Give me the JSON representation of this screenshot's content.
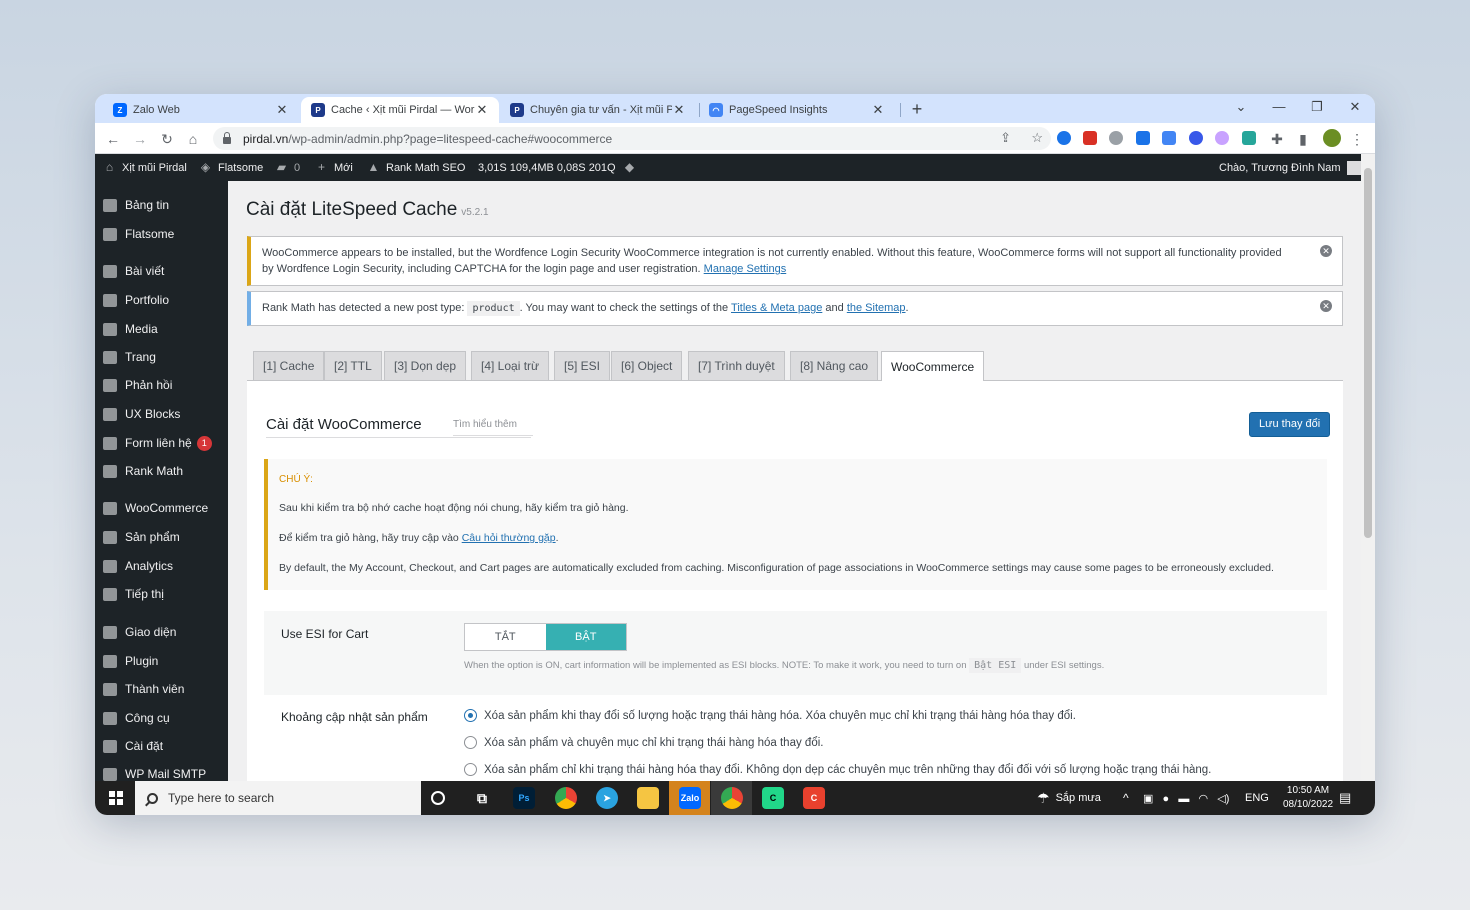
{
  "browser": {
    "tabs": [
      {
        "title": "Zalo Web",
        "favicon": "zalo-icon",
        "color": "#0068ff"
      },
      {
        "title": "Cache ‹ Xịt mũi Pirdal — WordPr",
        "favicon": "pirdal-icon",
        "color": "#1e3a8a"
      },
      {
        "title": "Chuyên gia tư vấn - Xịt mũi Pirda",
        "favicon": "pirdal-icon",
        "color": "#1e3a8a"
      },
      {
        "title": "PageSpeed Insights",
        "favicon": "pagespeed-icon",
        "color": "#4285f4"
      }
    ],
    "url_host": "pirdal.vn",
    "url_path": "/wp-admin/admin.php?page=litespeed-cache#woocommerce"
  },
  "adminbar": {
    "site": "Xịt mũi Pirdal",
    "flatsome": "Flatsome",
    "comments": "0",
    "new": "Mới",
    "rankmath": "Rank Math SEO",
    "stats": "3,01S  109,4MB  0,08S  201Q",
    "greeting": "Chào, Trương Đình Nam"
  },
  "sidebar": {
    "items": [
      {
        "label": "Bảng tin"
      },
      {
        "label": "Flatsome"
      },
      {
        "label": "Bài viết"
      },
      {
        "label": "Portfolio"
      },
      {
        "label": "Media"
      },
      {
        "label": "Trang"
      },
      {
        "label": "Phản hồi"
      },
      {
        "label": "UX Blocks"
      },
      {
        "label": "Form liên hệ",
        "badge": "1"
      },
      {
        "label": "Rank Math"
      },
      {
        "label": "WooCommerce"
      },
      {
        "label": "Sản phẩm"
      },
      {
        "label": "Analytics"
      },
      {
        "label": "Tiếp thị"
      },
      {
        "label": "Giao diện"
      },
      {
        "label": "Plugin"
      },
      {
        "label": "Thành viên"
      },
      {
        "label": "Công cụ"
      },
      {
        "label": "Cài đặt"
      },
      {
        "label": "WP Mail SMTP"
      }
    ]
  },
  "page": {
    "title": "Cài đặt LiteSpeed Cache",
    "version": "v5.2.1"
  },
  "notices": {
    "wordfence_text": "WooCommerce appears to be installed, but the Wordfence Login Security WooCommerce integration is not currently enabled. Without this feature, WooCommerce forms will not support all functionality provided by Wordfence Login Security, including CAPTCHA for the login page and user registration.",
    "wordfence_link": "Manage Settings",
    "rankmath_a": "Rank Math has detected a new post type:",
    "rankmath_code": "product",
    "rankmath_b": ". You may want to check the settings of the",
    "rankmath_link1": "Titles & Meta page",
    "rankmath_and": "and",
    "rankmath_link2": "the Sitemap",
    "rankmath_end": "."
  },
  "tabs": [
    "[1] Cache",
    "[2] TTL",
    "[3] Dọn dẹp",
    "[4] Loại trừ",
    "[5] ESI",
    "[6] Object",
    "[7] Trình duyệt",
    "[8] Nâng cao",
    "WooCommerce"
  ],
  "section": {
    "title": "Cài đặt WooCommerce",
    "learn_more": "Tìm hiểu thêm",
    "save": "Lưu thay đổi"
  },
  "note": {
    "label": "CHÚ Ý:",
    "line1": "Sau khi kiểm tra bộ nhớ cache hoạt động nói chung, hãy kiểm tra giỏ hàng.",
    "line2_a": "Để kiểm tra giỏ hàng, hãy truy cập vào",
    "line2_link": "Câu hỏi thường gặp",
    "line2_end": ".",
    "line3": "By default, the My Account, Checkout, and Cart pages are automatically excluded from caching. Misconfiguration of page associations in WooCommerce settings may cause some pages to be erroneously excluded."
  },
  "esi": {
    "label": "Use ESI for Cart",
    "off": "TẮT",
    "on": "BẬT",
    "help_a": "When the option is ON, cart information will be implemented as ESI blocks. NOTE: To make it work, you need to turn on",
    "help_code": "Bật ESI",
    "help_b": "under ESI settings."
  },
  "update": {
    "label": "Khoảng cập nhật sản phẩm",
    "options": [
      {
        "text": "Xóa sản phẩm khi thay đổi số lượng hoặc trạng thái hàng hóa. Xóa chuyên mục chỉ khi trạng thái hàng hóa thay đổi.",
        "checked": true
      },
      {
        "text": "Xóa sản phẩm và chuyên mục chỉ khi trạng thái hàng hóa thay đổi.",
        "checked": false
      },
      {
        "text": "Xóa sản phẩm chỉ khi trạng thái hàng hóa thay đổi. Không dọn dẹp các chuyên mục trên những thay đổi đối với số lượng hoặc trạng thái hàng.",
        "checked": false
      }
    ]
  },
  "taskbar": {
    "search_placeholder": "Type here to search",
    "weather": "Sắp mưa",
    "lang": "ENG",
    "time": "10:50 AM",
    "date": "08/10/2022"
  }
}
